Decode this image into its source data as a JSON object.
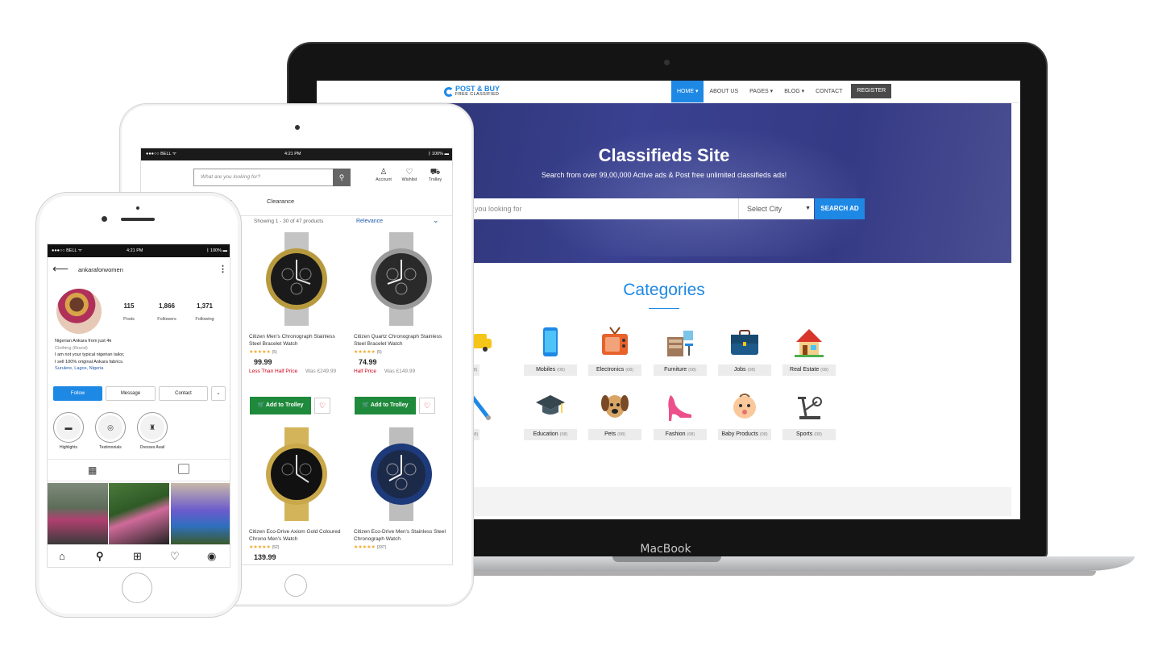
{
  "laptop": {
    "brand_label": "MacBook",
    "site": {
      "logo_top": "POST & BUY",
      "logo_bottom": "FREE CLASSIFIED",
      "nav": [
        {
          "label": "HOME ▾"
        },
        {
          "label": "ABOUT US"
        },
        {
          "label": "PAGES ▾"
        },
        {
          "label": "BLOG ▾"
        },
        {
          "label": "CONTACT"
        },
        {
          "label": "REGISTER"
        }
      ],
      "hero_title": "Classifieds Site",
      "hero_subtitle": "Search from over 99,00,000 Active ads & Post free unlimited classifieds ads!",
      "search_value": "you looking for",
      "city_select": "Select City",
      "search_button": "SEARCH AD",
      "categories_title": "Categories",
      "categories": [
        {
          "label": "les",
          "count": "(08)",
          "icon": "car-icon"
        },
        {
          "label": "Mobiles",
          "count": "(08)",
          "icon": "mobile-icon"
        },
        {
          "label": "Electronics",
          "count": "(08)",
          "icon": "tv-icon"
        },
        {
          "label": "Furniture",
          "count": "(08)",
          "icon": "furniture-icon"
        },
        {
          "label": "Jobs",
          "count": "(08)",
          "icon": "briefcase-icon"
        },
        {
          "label": "Real Estate",
          "count": "(08)",
          "icon": "house-icon"
        },
        {
          "label": "ces",
          "count": "(08)",
          "icon": "tools-icon"
        },
        {
          "label": "Education",
          "count": "(08)",
          "icon": "graduation-cap-icon"
        },
        {
          "label": "Pets",
          "count": "(08)",
          "icon": "dog-icon"
        },
        {
          "label": "Fashion",
          "count": "(08)",
          "icon": "high-heel-icon"
        },
        {
          "label": "Baby Products",
          "count": "(08)",
          "icon": "baby-icon"
        },
        {
          "label": "Sports",
          "count": "(08)",
          "icon": "exercise-bike-icon"
        }
      ]
    }
  },
  "tablet": {
    "status": {
      "left": "●●●○○ BELL ᯤ",
      "time": "4:21 PM",
      "right": "ᛒ 100% ▬"
    },
    "search_placeholder": "What are you looking for?",
    "account": "Account",
    "wishlist": "Wishlist",
    "trolley": "Trolley",
    "tabs": [
      "rden",
      "Clearance"
    ],
    "result_count": "Showing 1 - 30 of 47 products",
    "sort": "Relevance",
    "add_label": "Add to Trolley",
    "products": [
      {
        "name": "Citizen Men's Chronograph Stainless Steel Bracelet Watch",
        "stars": "★★★★★",
        "reviews": "(5)",
        "price": "99.99",
        "badge": "Less Than Half Price",
        "was": "Was £249.99",
        "dial": "#1a1a1a",
        "bezel": "#b89a3e"
      },
      {
        "name": "Citizen Quartz Chronograph Stainless Steel Bracelet Watch",
        "stars": "★★★★★",
        "reviews": "(5)",
        "price": "74.99",
        "badge": "Half Price",
        "was": "Was £149.99",
        "dial": "#2a2a2a",
        "bezel": "#9a9a9a"
      },
      {
        "name": "Citizen Eco-Drive Axiom Gold Coloured Chrono Men's Watch",
        "stars": "★★★★★",
        "reviews": "(52)",
        "price": "139.99",
        "dial": "#111111",
        "bezel": "#c9a84a"
      },
      {
        "name": "Citizen Eco-Drive Men's Stainless Steel Chronograph Watch",
        "stars": "★★★★★",
        "reviews": "(337)",
        "dial": "#1c2a4a",
        "bezel": "#1d3a7a"
      }
    ]
  },
  "phone": {
    "status": {
      "left": "●●●○○ BELL ᯤ",
      "time": "4:21 PM",
      "right": "ᛒ 100% ▬"
    },
    "username": "ankaraforwomen",
    "posts": "115",
    "posts_label": "Posts",
    "followers": "1,866",
    "followers_label": "Followers",
    "following": "1,371",
    "following_label": "Following",
    "bio_name": "Nigerian Ankara from just 4k",
    "bio_category": "Clothing (Brand)",
    "bio_line1": "I am not your typical nigerian tailor,",
    "bio_line2": "I sell 100% original Ankara fabrics.",
    "bio_location": "Surulere, Lagos, Nigeria",
    "follow": "Follow",
    "message": "Message",
    "contact": "Contact",
    "highlights": [
      "Highlights",
      "Testimonials",
      "Dresses Avail"
    ]
  }
}
